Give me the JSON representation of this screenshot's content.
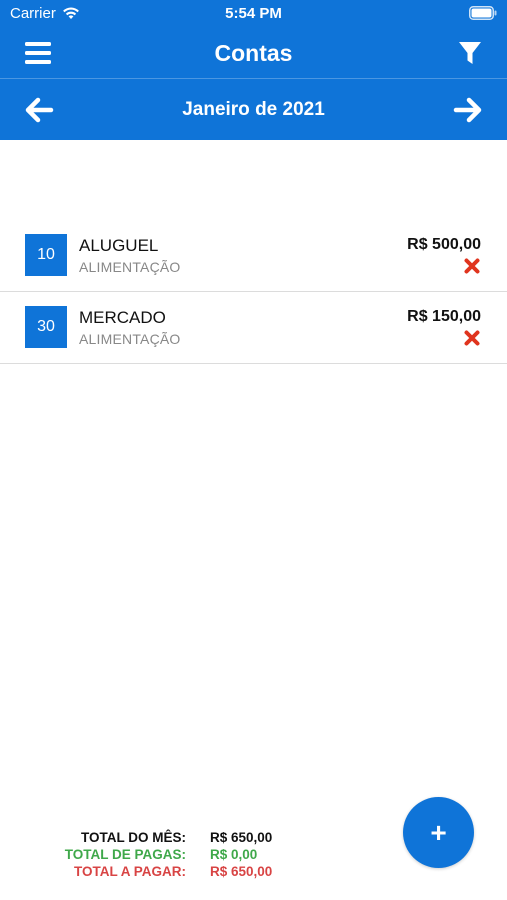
{
  "status_bar": {
    "carrier": "Carrier",
    "time": "5:54 PM"
  },
  "navbar": {
    "title": "Contas",
    "menu_icon": "hamburger-icon",
    "filter_icon": "funnel-icon"
  },
  "month_selector": {
    "label": "Janeiro de 2021",
    "prev_icon": "arrow-left-icon",
    "next_icon": "arrow-right-icon"
  },
  "bills": [
    {
      "day": "10",
      "name": "ALUGUEL",
      "category": "ALIMENTAÇÃO",
      "value": "R$ 500,00",
      "status_icon": "red-x-icon"
    },
    {
      "day": "30",
      "name": "MERCADO",
      "category": "ALIMENTAÇÃO",
      "value": "R$ 150,00",
      "status_icon": "red-x-icon"
    }
  ],
  "totals": {
    "month_label": "TOTAL DO MÊS:",
    "month_value": "R$ 650,00",
    "paid_label": "TOTAL DE PAGAS:",
    "paid_value": "R$ 0,00",
    "to_pay_label": "TOTAL A PAGAR:",
    "to_pay_value": "R$ 650,00"
  },
  "fab": {
    "label": "+"
  },
  "colors": {
    "primary": "#0f74d8",
    "paid": "#3fa84a",
    "unpaid": "#d84444",
    "delete": "#e0341e"
  }
}
